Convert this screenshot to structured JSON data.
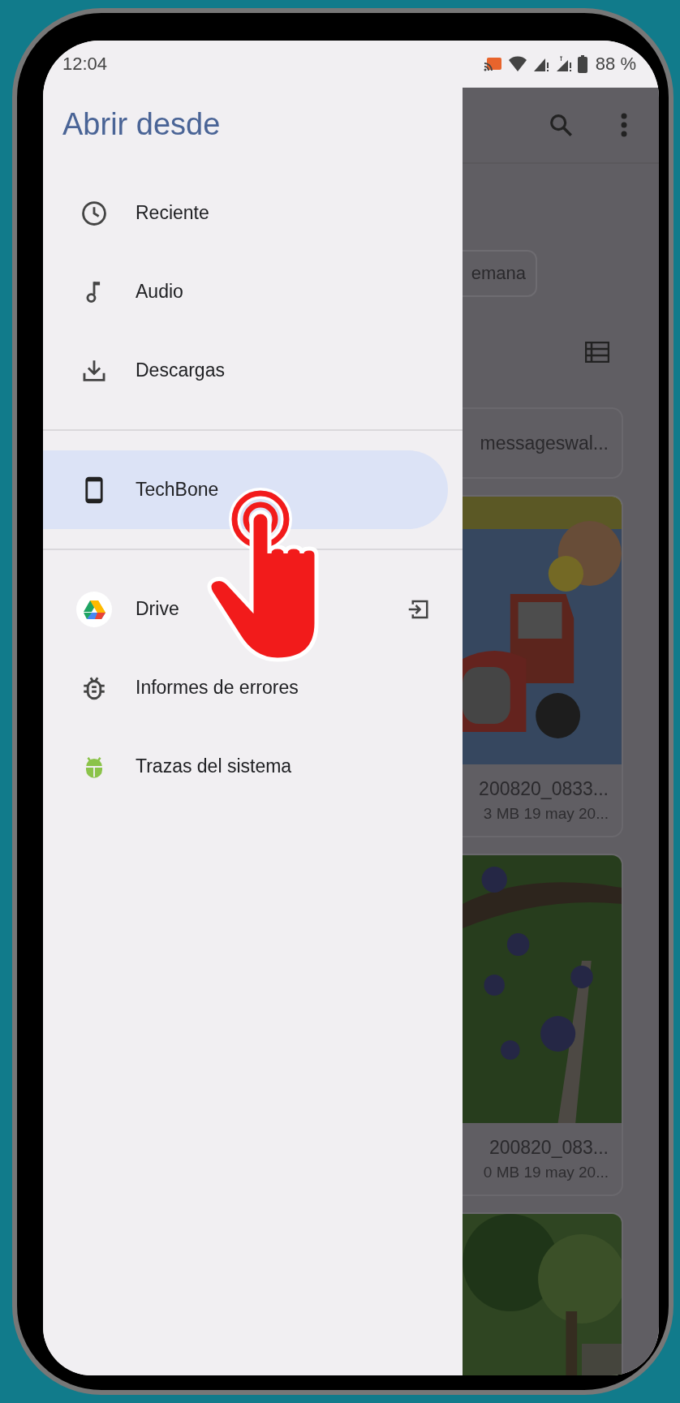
{
  "status_bar": {
    "time": "12:04",
    "battery": "88 %"
  },
  "drawer": {
    "title": "Abrir desde",
    "sections": [
      {
        "items": [
          {
            "kind": "clock",
            "label": "Reciente",
            "selected": false,
            "eject": false
          },
          {
            "kind": "note",
            "label": "Audio",
            "selected": false,
            "eject": false
          },
          {
            "kind": "download",
            "label": "Descargas",
            "selected": false,
            "eject": false
          }
        ]
      },
      {
        "items": [
          {
            "kind": "phone",
            "label": "TechBone",
            "selected": true,
            "eject": false
          }
        ]
      },
      {
        "items": [
          {
            "kind": "drive",
            "label": "Drive",
            "selected": false,
            "eject": true
          },
          {
            "kind": "bug",
            "label": "Informes de errores",
            "selected": false,
            "eject": false
          },
          {
            "kind": "android",
            "label": "Trazas del sistema",
            "selected": false,
            "eject": false
          }
        ]
      }
    ]
  },
  "background": {
    "chip": "emana",
    "files": [
      {
        "kind": "folder",
        "name": "messageswal..."
      },
      {
        "kind": "picture",
        "name": "200820_0833...",
        "meta": "3 MB 19 may 20..."
      },
      {
        "kind": "picture",
        "name": "200820_083...",
        "meta": "0 MB 19 may 20..."
      },
      {
        "kind": "picture"
      }
    ]
  }
}
